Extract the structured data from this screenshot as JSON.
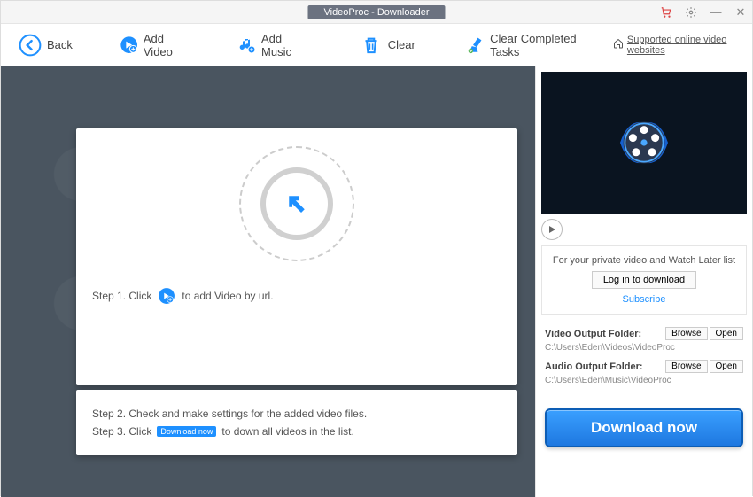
{
  "titlebar": {
    "title": "VideoProc - Downloader"
  },
  "toolbar": {
    "back": "Back",
    "add_video": "Add Video",
    "add_music": "Add Music",
    "clear": "Clear",
    "clear_completed": "Clear Completed Tasks",
    "supported": "Supported online video websites"
  },
  "steps": {
    "s1a": "Step 1. Click",
    "s1b": "to add Video by url.",
    "s2": "Step 2. Check and make settings for the added video files.",
    "s3a": "Step 3. Click",
    "s3b": "to down all videos in the list.",
    "mini_btn": "Download now"
  },
  "login": {
    "msg": "For your private video and Watch Later list",
    "btn": "Log in to download",
    "subscribe": "Subscribe"
  },
  "folders": {
    "video_label": "Video Output Folder:",
    "video_path": "C:\\Users\\Eden\\Videos\\VideoProc",
    "audio_label": "Audio Output Folder:",
    "audio_path": "C:\\Users\\Eden\\Music\\VideoProc",
    "browse": "Browse",
    "open": "Open"
  },
  "download_btn": "Download now"
}
